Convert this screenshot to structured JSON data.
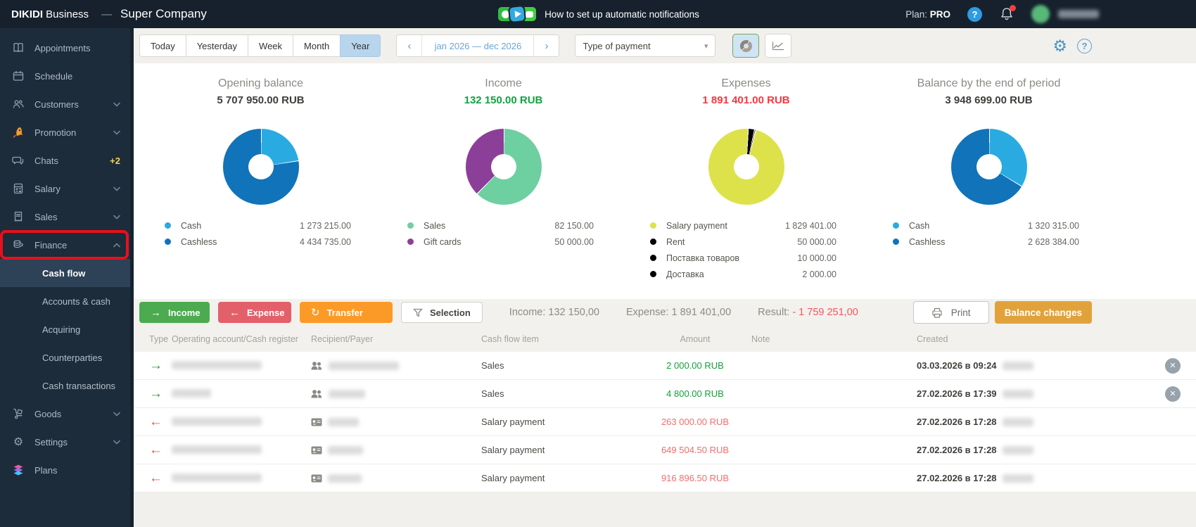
{
  "topbar": {
    "brand_bold": "DIKIDI",
    "brand_light": "Business",
    "dash": "—",
    "company": "Super Company",
    "banner": "How to set up automatic notifications",
    "plan_label": "Plan:",
    "plan_value": "PRO",
    "help_glyph": "?"
  },
  "sidebar": {
    "items": [
      {
        "label": "Appointments",
        "icon": "book-icon"
      },
      {
        "label": "Schedule",
        "icon": "calendar-icon"
      },
      {
        "label": "Customers",
        "icon": "customers-icon",
        "chevron": "down"
      },
      {
        "label": "Promotion",
        "icon": "rocket-icon",
        "chevron": "down"
      },
      {
        "label": "Chats",
        "icon": "chat-icon",
        "badge": "+2"
      },
      {
        "label": "Salary",
        "icon": "calculator-icon",
        "chevron": "down"
      },
      {
        "label": "Sales",
        "icon": "receipt-icon",
        "chevron": "down"
      },
      {
        "label": "Finance",
        "icon": "coins-icon",
        "chevron": "up",
        "annotated": true
      },
      {
        "label": "Goods",
        "icon": "handtruck-icon",
        "chevron": "down"
      },
      {
        "label": "Settings",
        "icon": "gear-icon",
        "chevron": "down"
      },
      {
        "label": "Plans",
        "icon": "layers-icon"
      }
    ],
    "finance_submenu": [
      "Cash flow",
      "Accounts & cash",
      "Acquiring",
      "Counterparties",
      "Cash transactions"
    ],
    "active_submenu": "Cash flow",
    "annotation_color": "#e8101c"
  },
  "filters": {
    "periods": [
      "Today",
      "Yesterday",
      "Week",
      "Month",
      "Year"
    ],
    "active_period": "Year",
    "prev_arrow": "‹",
    "next_arrow": "›",
    "date_range": "jan 2026 — dec 2026",
    "payment_type": "Type of payment",
    "view_toggles": [
      "donut-chart-view",
      "line-chart-view"
    ],
    "active_view": "donut-chart-view"
  },
  "chart_data": [
    {
      "type": "pie",
      "title": "Opening balance",
      "total_label": "5 707 950.00 RUB",
      "start_angle": 0,
      "slices": [
        {
          "label": "Cash",
          "value": 1273215.0,
          "value_label": "1 273 215.00",
          "color": "#29abe2"
        },
        {
          "label": "Cashless",
          "value": 4434735.0,
          "value_label": "4 434 735.00",
          "color": "#1173b9"
        }
      ]
    },
    {
      "type": "pie",
      "title": "Income",
      "total_label": "132 150.00 RUB",
      "start_angle": 0,
      "slices": [
        {
          "label": "Sales",
          "value": 82150.0,
          "value_label": "82 150.00",
          "color": "#6ecfa1"
        },
        {
          "label": "Gift cards",
          "value": 50000.0,
          "value_label": "50 000.00",
          "color": "#8c3f98"
        }
      ]
    },
    {
      "type": "pie",
      "title": "Expenses",
      "total_label": "1 891 401.00 RUB",
      "start_angle": 14,
      "slices": [
        {
          "label": "Salary payment",
          "value": 1829401.0,
          "value_label": "1 829 401.00",
          "color": "#dde24b"
        },
        {
          "label": "Rent",
          "value": 50000.0,
          "value_label": "50 000.00",
          "color": "#000000"
        },
        {
          "label": "Поставка товаров",
          "value": 10000.0,
          "value_label": "10 000.00",
          "color": "#000000"
        },
        {
          "label": "Доставка",
          "value": 2000.0,
          "value_label": "2 000.00",
          "color": "#000000"
        }
      ]
    },
    {
      "type": "pie",
      "title": "Balance by the end of period",
      "total_label": "3 948 699.00 RUB",
      "start_angle": 0,
      "slices": [
        {
          "label": "Cash",
          "value": 1320315.0,
          "value_label": "1 320 315.00",
          "color": "#29abe2"
        },
        {
          "label": "Cashless",
          "value": 2628384.0,
          "value_label": "2 628 384.00",
          "color": "#1173b9"
        }
      ]
    }
  ],
  "actions": {
    "income_button": "Income",
    "income_arrow": "→",
    "expense_button": "Expense",
    "expense_arrow": "←",
    "transfer_button": "Transfer",
    "transfer_arrow": "↻",
    "selection_button": "Selection",
    "income_total": "Income: 132 150,00",
    "expense_total": "Expense: 1 891 401,00",
    "result_label": "Result:",
    "result_value": "- 1 759 251,00",
    "print_button": "Print",
    "balance_changes_button": "Balance changes"
  },
  "table": {
    "columns": [
      "Type",
      "Operating account/Cash register",
      "Recipient/Payer",
      "Cash flow item",
      "Amount",
      "Note",
      "Created"
    ],
    "rows": [
      {
        "kind": "income",
        "arrow": "→",
        "recipient_icon": "people-icon",
        "item": "Sales",
        "amount": "2 000.00 RUB",
        "note": "",
        "created": "03.03.2026 в 09:24",
        "deletable": true
      },
      {
        "kind": "income",
        "arrow": "→",
        "recipient_icon": "people-icon",
        "item": "Sales",
        "amount": "4 800.00 RUB",
        "note": "",
        "created": "27.02.2026 в 17:39",
        "deletable": true
      },
      {
        "kind": "expense",
        "arrow": "←",
        "recipient_icon": "card-icon",
        "item": "Salary payment",
        "amount": "263 000.00 RUB",
        "note": "",
        "created": "27.02.2026 в 17:28"
      },
      {
        "kind": "expense",
        "arrow": "←",
        "recipient_icon": "card-icon",
        "item": "Salary payment",
        "amount": "649 504.50 RUB",
        "note": "",
        "created": "27.02.2026 в 17:28"
      },
      {
        "kind": "expense",
        "arrow": "←",
        "recipient_icon": "card-icon",
        "item": "Salary payment",
        "amount": "916 896.50 RUB",
        "note": "",
        "created": "27.02.2026 в 17:28"
      }
    ],
    "delete_glyph": "✕"
  }
}
